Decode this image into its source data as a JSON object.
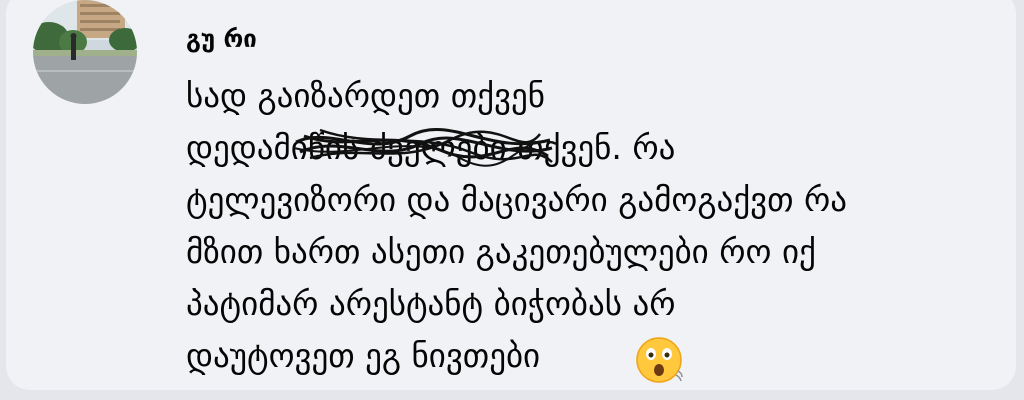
{
  "comment": {
    "author": "გუ რი",
    "lines": [
      "სად გაიზარდეთ თქვენ",
      "დედამიწის ძველები თქვენ. რა",
      "ტელევიზორი და მაცივარი გამოგაქვთ რა",
      "მზით ხართ ასეთი გაკეთებულები რო იქ",
      "პატიმარ არესტანტ ბიჭობას არ",
      "დაუტოვეთ ეგ ნივთები"
    ],
    "emoji": "astonished-face"
  },
  "colors": {
    "page_background": "#e4e6eb",
    "bubble_background": "#f0f2f5",
    "text": "#050505",
    "emoji_yellow": "#ffc83d"
  }
}
